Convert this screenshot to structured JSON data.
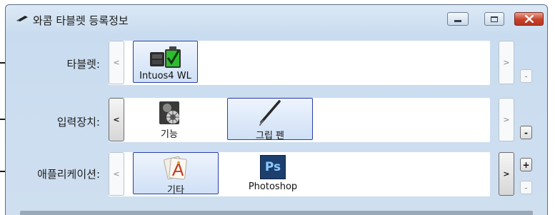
{
  "window": {
    "title": "와콤 타블렛 등록정보",
    "controls": {
      "minimize": "minimize-button",
      "maximize": "maximize-button",
      "close": "close-button"
    }
  },
  "rows": {
    "tablet": {
      "label": "타블렛:",
      "prev": "<",
      "next": ">",
      "remove": "-",
      "items": [
        {
          "label": "Intuos4 WL",
          "icon": "tablet-icon",
          "selected": true
        }
      ]
    },
    "input": {
      "label": "입력장치:",
      "prev": "<",
      "next": ">",
      "remove": "-",
      "items": [
        {
          "label": "기능",
          "icon": "functions-icon",
          "selected": false
        },
        {
          "label": "그립 펜",
          "icon": "grip-pen-icon",
          "selected": true
        }
      ]
    },
    "application": {
      "label": "애플리케이션:",
      "prev": "<",
      "next": ">",
      "add": "+",
      "remove": "-",
      "items": [
        {
          "label": "기타",
          "icon": "other-apps-icon",
          "selected": true
        },
        {
          "label": "Photoshop",
          "icon": "photoshop-icon",
          "selected": false,
          "badge": "Ps"
        }
      ]
    }
  },
  "colors": {
    "selection_border": "#2a3ea8",
    "close_button": "#c7412a",
    "photoshop_blue": "#1c3f6e",
    "photoshop_text": "#8ecbff"
  }
}
